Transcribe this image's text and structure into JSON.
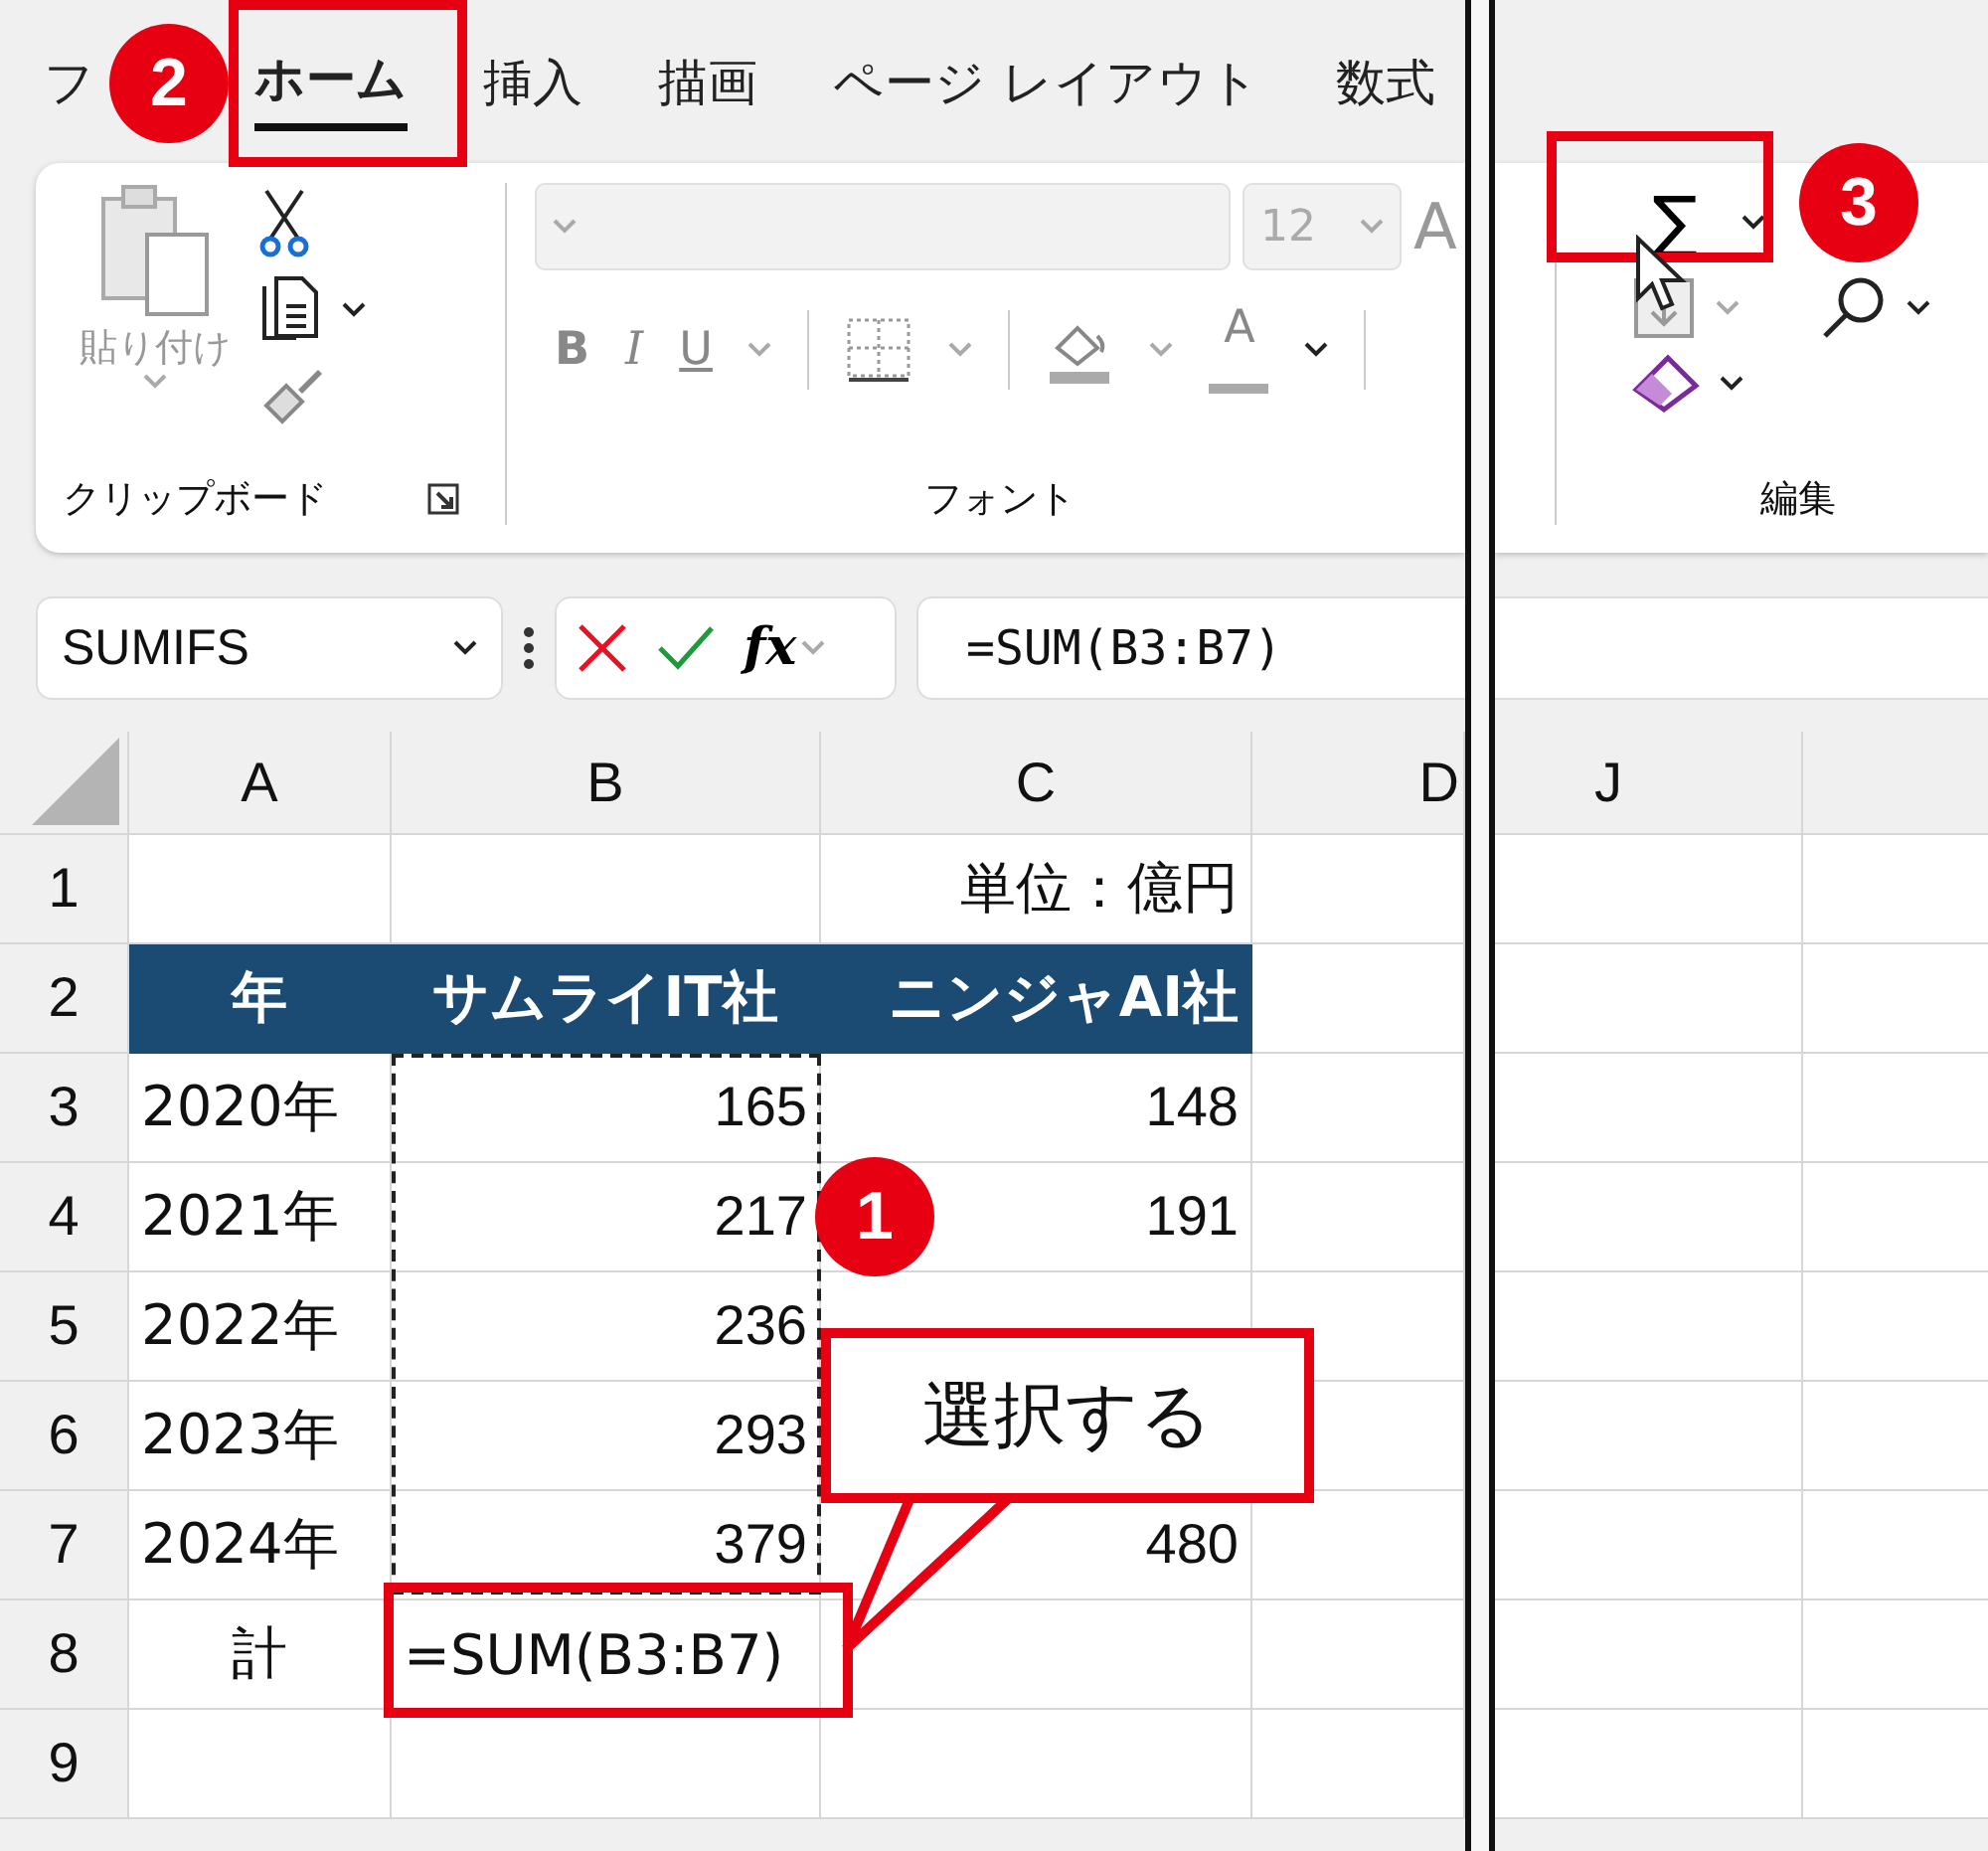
{
  "ribbon_tabs": [
    {
      "label": "フ",
      "selected": false
    },
    {
      "label": "ホーム",
      "selected": true
    },
    {
      "label": "挿入",
      "selected": false
    },
    {
      "label": "描画",
      "selected": false
    },
    {
      "label": "ページ レイアウト",
      "selected": false
    },
    {
      "label": "数式",
      "selected": false
    }
  ],
  "clipboard": {
    "paste_label": "貼り付け",
    "paste_disabled": true,
    "group_label": "クリップボード"
  },
  "font": {
    "size": "12",
    "grow_font": "A",
    "bold": "B",
    "italic": "I",
    "underline": "U",
    "font_color": "A",
    "group_label": "フォント",
    "disabled": true
  },
  "editing": {
    "autosum": "∑",
    "group_label": "編集"
  },
  "formula_bar": {
    "name_box": "SUMIFS",
    "function_button": "fx",
    "formula": "=SUM(B3:B7)"
  },
  "left_columns": [
    "A",
    "B",
    "C",
    "D"
  ],
  "right_columns": [
    "J"
  ],
  "rows": [
    {
      "number": "1",
      "kind": "data",
      "c": "単位：億円"
    },
    {
      "number": "2",
      "kind": "header",
      "a": "年",
      "b": "サムライIT社",
      "c": "ニンジャAI社"
    },
    {
      "number": "3",
      "kind": "data",
      "a": "2020年",
      "b": "165",
      "c": "148"
    },
    {
      "number": "4",
      "kind": "data",
      "a": "2021年",
      "b": "217",
      "c": "191"
    },
    {
      "number": "5",
      "kind": "data",
      "a": "2022年",
      "b": "236"
    },
    {
      "number": "6",
      "kind": "data",
      "a": "2023年",
      "b": "293"
    },
    {
      "number": "7",
      "kind": "data",
      "a": "2024年",
      "b": "379",
      "c": "480"
    },
    {
      "number": "8",
      "kind": "total",
      "a": "計",
      "b": "=SUM(B3:B7)"
    },
    {
      "number": "9",
      "kind": "data"
    }
  ],
  "badges": [
    {
      "number": "2"
    },
    {
      "number": "3"
    },
    {
      "number": "1"
    }
  ],
  "callout": {
    "text": "選択する"
  }
}
